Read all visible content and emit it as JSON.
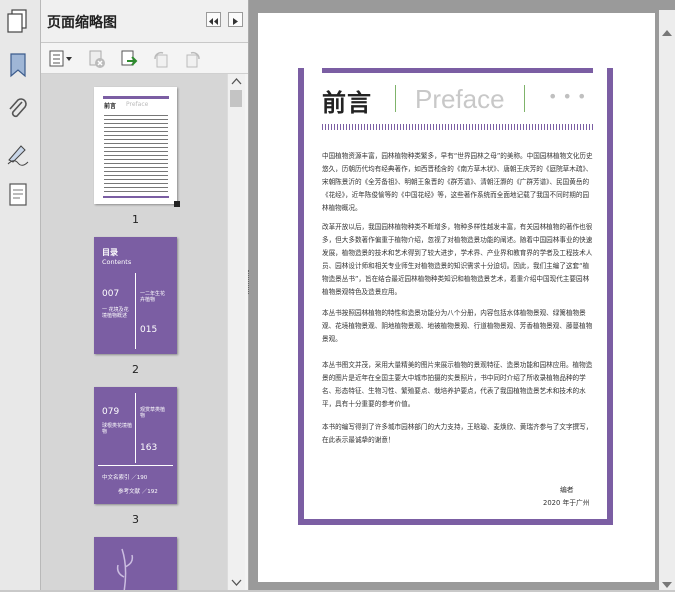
{
  "panel": {
    "title": "页面缩略图"
  },
  "thumbnails": [
    {
      "label": "1"
    },
    {
      "label": "2"
    },
    {
      "label": "3"
    }
  ],
  "thumb1": {
    "title_cn": "前言",
    "title_en": "Preface"
  },
  "thumb2": {
    "heading": "目录",
    "heading_en": "Contents",
    "items": [
      {
        "num": "007",
        "text": "一 花境及花境植物概述"
      },
      {
        "num": "015",
        "text": "一二年生花卉植物"
      }
    ]
  },
  "thumb3": {
    "items": [
      {
        "num": "079",
        "text": "球根类花境植物"
      },
      {
        "num": "163",
        "text": "观赏草类植物"
      }
    ],
    "footer1": "中文名索引 ／190",
    "footer2": "参考文献 ／192"
  },
  "doc": {
    "title_cn": "前言",
    "title_en": "Preface",
    "dots": "• • •",
    "paragraphs": [
      "中国植物资源丰富，园林植物种类繁多，早有“世界园林之母”的美称。中国园林植物文化历史悠久，历朝历代均有经典著作，如西晋嵇含的《南方草木状》、唐朝王庆芳的《庭院草木疏》、宋朝陈景沂的《全芳备祖》、明朝王象晋的《群芳谱》、清朝汪灏的《广群芳谱》、民国黄岳的《花经》，近年陈俊愉等的《中国花经》等，这些著作系统而全面地记载了我国不同时期的园林植物概况。",
      "改革开放以后，我国园林植物种类不断增多，物种多样性越发丰富，有关园林植物的著作也很多，但大多数著作偏重于植物介绍，忽视了对植物造景功能的阐述。随着中国园林事业的快速发展，植物造景的技术和艺术得到了较大进步，学术界、产业界和教育界的学者及工程技术人员、园林设计师和相关专业师生对植物造景的知识需求十分迫切。因此，我们主编了这套“植物造景丛书”，旨在结合最近园林植物种类知识和植物造景艺术，着重介绍中国现代主要园林植物景观特色及造景应用。",
      "本丛书按照园林植物的特性和造景功能分为八个分册，内容包括水体植物景观、绿篱植物景观、花境植物景观、阴地植物景观、地被植物景观、行道植物景观、芳香植物景观、藤蔓植物景观。",
      "本丛书图文并茂，采用大量精美的图片来展示植物的景观特征、造景功能和园林应用。植物造景的图片是近年在全国主要大中城市拍摄的实景照片，书中同时介绍了所收录植物品种的学名、形态特征、生物习性、繁殖要点、栽培养护要点，代表了我国植物造景艺术和技术的水平，具有十分重要的参考价值。",
      "本书的编写得到了许多城市园林部门的大力支持，王晗璇、麦焕欣、黄瑞齐参与了文字撰写，在此表示最诚挚的谢意！"
    ],
    "sign": "编者",
    "date": "2020 年于广州"
  },
  "colors": {
    "accent": "#7b5ea3",
    "panel_bg": "#f4f4f4",
    "viewer_bg": "#9a9a9a"
  },
  "icons": [
    "pages-icon",
    "bookmark-icon",
    "attachment-icon",
    "signature-icon",
    "document-properties-icon",
    "collapse-panel-icon",
    "expand-panel-icon",
    "options-menu-icon",
    "delete-page-icon",
    "insert-page-icon",
    "rotate-ccw-icon",
    "rotate-cw-icon"
  ]
}
